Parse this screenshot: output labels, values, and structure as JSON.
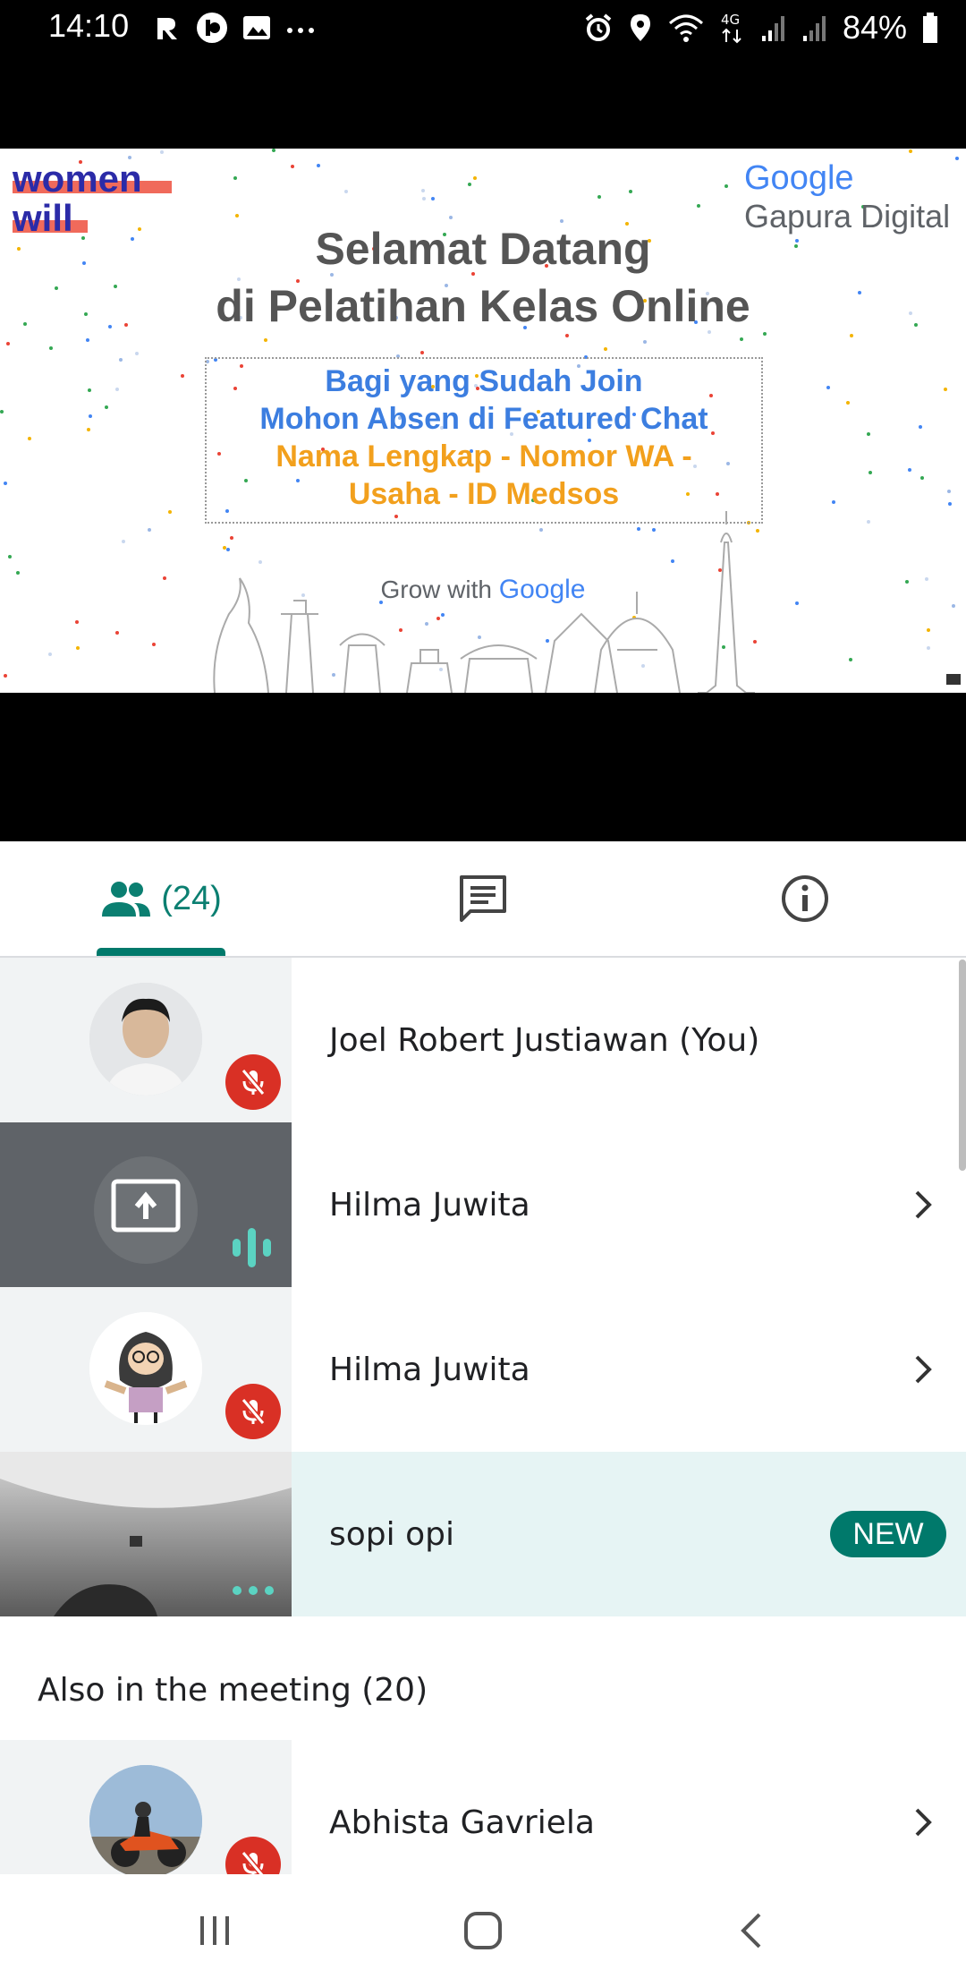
{
  "status_bar": {
    "time": "14:10",
    "network": "4G",
    "battery": "84%"
  },
  "slide": {
    "logo_left_line1": "women",
    "logo_left_line2": "will",
    "logo_right_line1": "Google",
    "logo_right_line2": "Gapura Digital",
    "title_line1": "Selamat Datang",
    "title_line2": "di Pelatihan Kelas Online",
    "box_line1": "Bagi yang Sudah Join",
    "box_line2": "Mohon Absen di Featured Chat",
    "box_line3": "Nama Lengkap - Nomor WA -",
    "box_line4": "Usaha - ID Medsos",
    "footer_prefix": "Grow with",
    "footer_brand": "Google"
  },
  "tabs": {
    "people_count": "(24)",
    "people_icon": "people-icon",
    "chat_icon": "chat-icon",
    "info_icon": "info-icon"
  },
  "participants": [
    {
      "name": "Joel Robert Justiawan (You)",
      "status": "muted"
    },
    {
      "name": "Hilma Juwita",
      "status": "presenting"
    },
    {
      "name": "Hilma Juwita",
      "status": "muted"
    },
    {
      "name": "sopi opi",
      "badge": "NEW"
    }
  ],
  "also_in_meeting": {
    "label": "Also in the meeting (20)",
    "first": {
      "name": "Abhista Gavriela",
      "status": "muted"
    }
  },
  "colors": {
    "accent": "#00796b",
    "mute_red": "#d93025",
    "highlight_row": "#e6f4f4"
  }
}
